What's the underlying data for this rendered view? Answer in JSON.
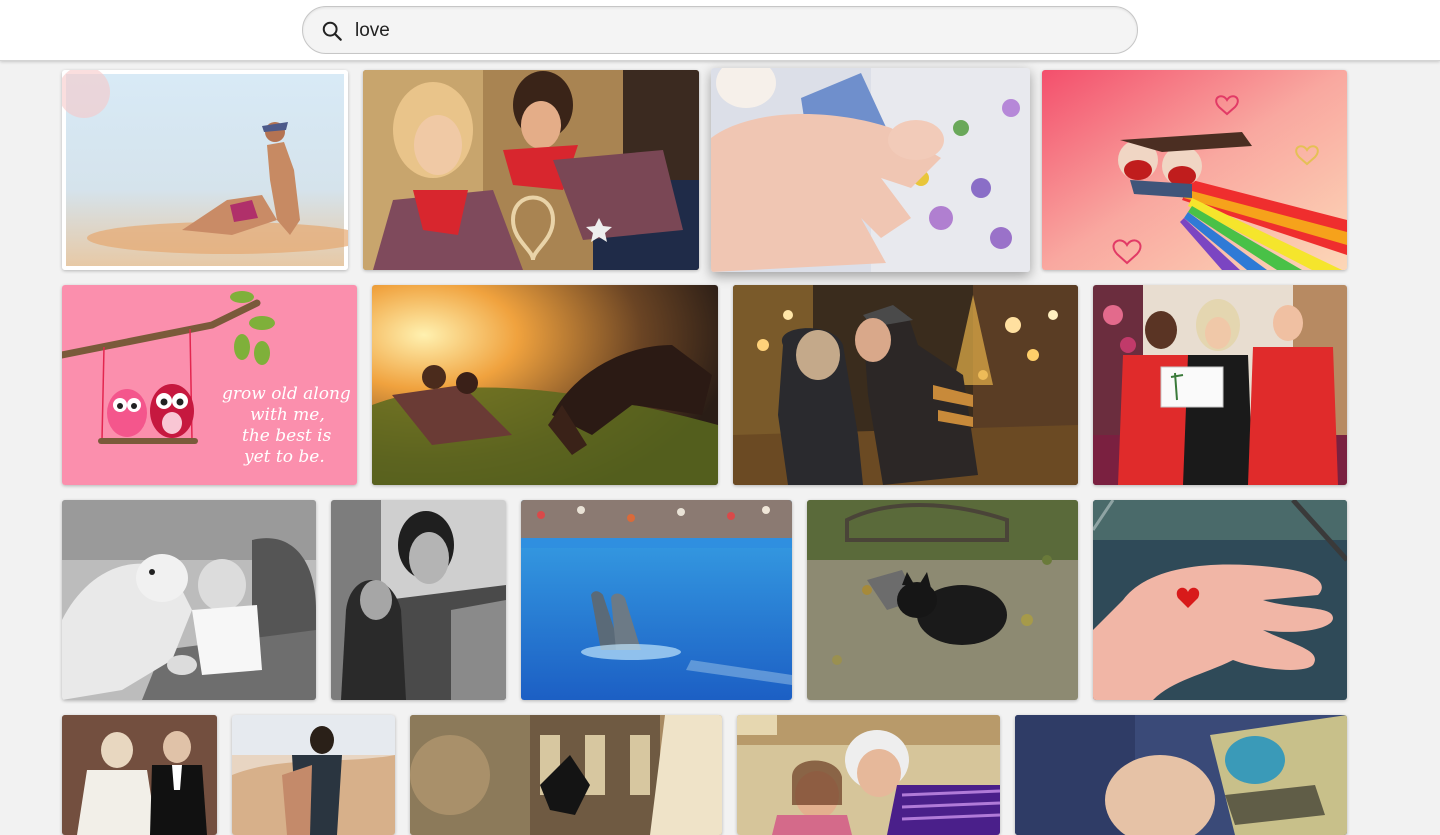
{
  "search": {
    "query": "love",
    "icon": "search-icon"
  },
  "gallery": {
    "photos": [
      {
        "id": "beach-couple",
        "subject": "couple lying in shallow sea water"
      },
      {
        "id": "cowboy-couple",
        "subject": "couple in plaid shirts with rope heart"
      },
      {
        "id": "baby-hand",
        "subject": "baby holding adult finger on floral cloth"
      },
      {
        "id": "rainbow-cartoon",
        "subject": "cartoon couple flying on rainbow"
      },
      {
        "id": "owls-card",
        "subject": "owls on a swing card",
        "text_lines": [
          "grow old along",
          "with me,",
          "the best is",
          "yet to be."
        ]
      },
      {
        "id": "sunset-horse",
        "subject": "couple in grass with horse at sunset"
      },
      {
        "id": "winter-kiss",
        "subject": "couple kissing on lit street at night"
      },
      {
        "id": "certificate-group",
        "subject": "three people holding a certificate"
      },
      {
        "id": "baby-dog",
        "subject": "baby with dog black and white"
      },
      {
        "id": "bw-couple",
        "subject": "couple embracing black and white"
      },
      {
        "id": "dolphins",
        "subject": "two dolphins in pool"
      },
      {
        "id": "black-cat",
        "subject": "black cat on ground"
      },
      {
        "id": "hand-heart",
        "subject": "hand holding small red heart"
      },
      {
        "id": "wedding-couple",
        "subject": "vintage wedding couple"
      },
      {
        "id": "desert-couple",
        "subject": "couple embracing in desert"
      },
      {
        "id": "plaza-statue",
        "subject": "statue in city square"
      },
      {
        "id": "grandmother-child",
        "subject": "grandmother with child"
      },
      {
        "id": "sleeping-baby",
        "subject": "sleeping baby with toy"
      }
    ]
  },
  "colors": {
    "page_bg": "#f2f2f2",
    "owl_card_pink": "#fb8fad"
  }
}
